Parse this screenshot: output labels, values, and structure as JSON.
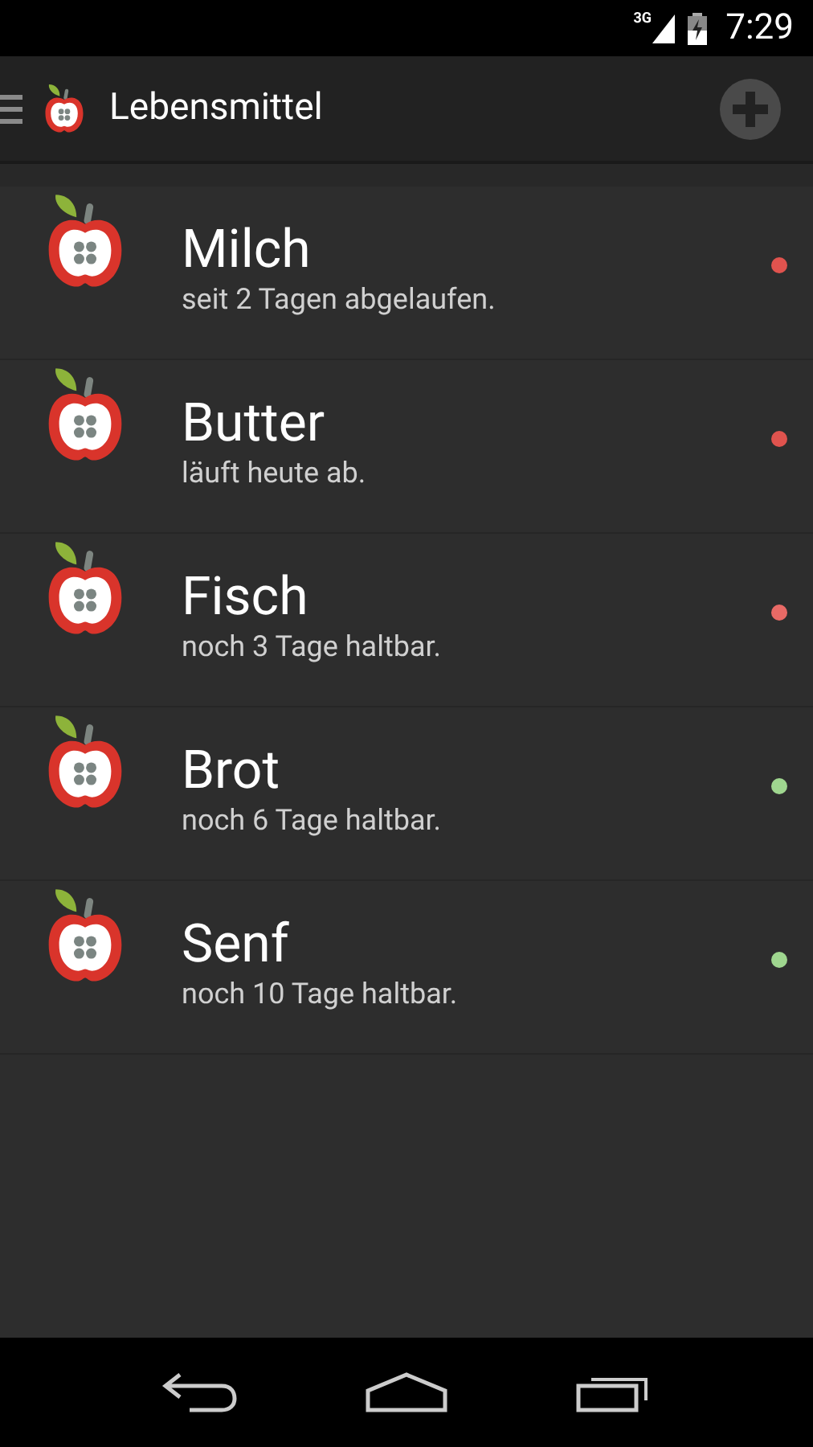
{
  "status_bar": {
    "network": "3G",
    "time": "7:29"
  },
  "action_bar": {
    "title": "Lebensmittel"
  },
  "items": [
    {
      "name": "Milch",
      "status": "seit 2 Tagen abgelaufen.",
      "color": "#e0534e"
    },
    {
      "name": "Butter",
      "status": "läuft heute ab.",
      "color": "#e0534e"
    },
    {
      "name": "Fisch",
      "status": "noch 3 Tage haltbar.",
      "color": "#e86a66"
    },
    {
      "name": "Brot",
      "status": "noch 6 Tage haltbar.",
      "color": "#9fd68f"
    },
    {
      "name": "Senf",
      "status": "noch 10 Tage haltbar.",
      "color": "#9fd68f"
    }
  ]
}
